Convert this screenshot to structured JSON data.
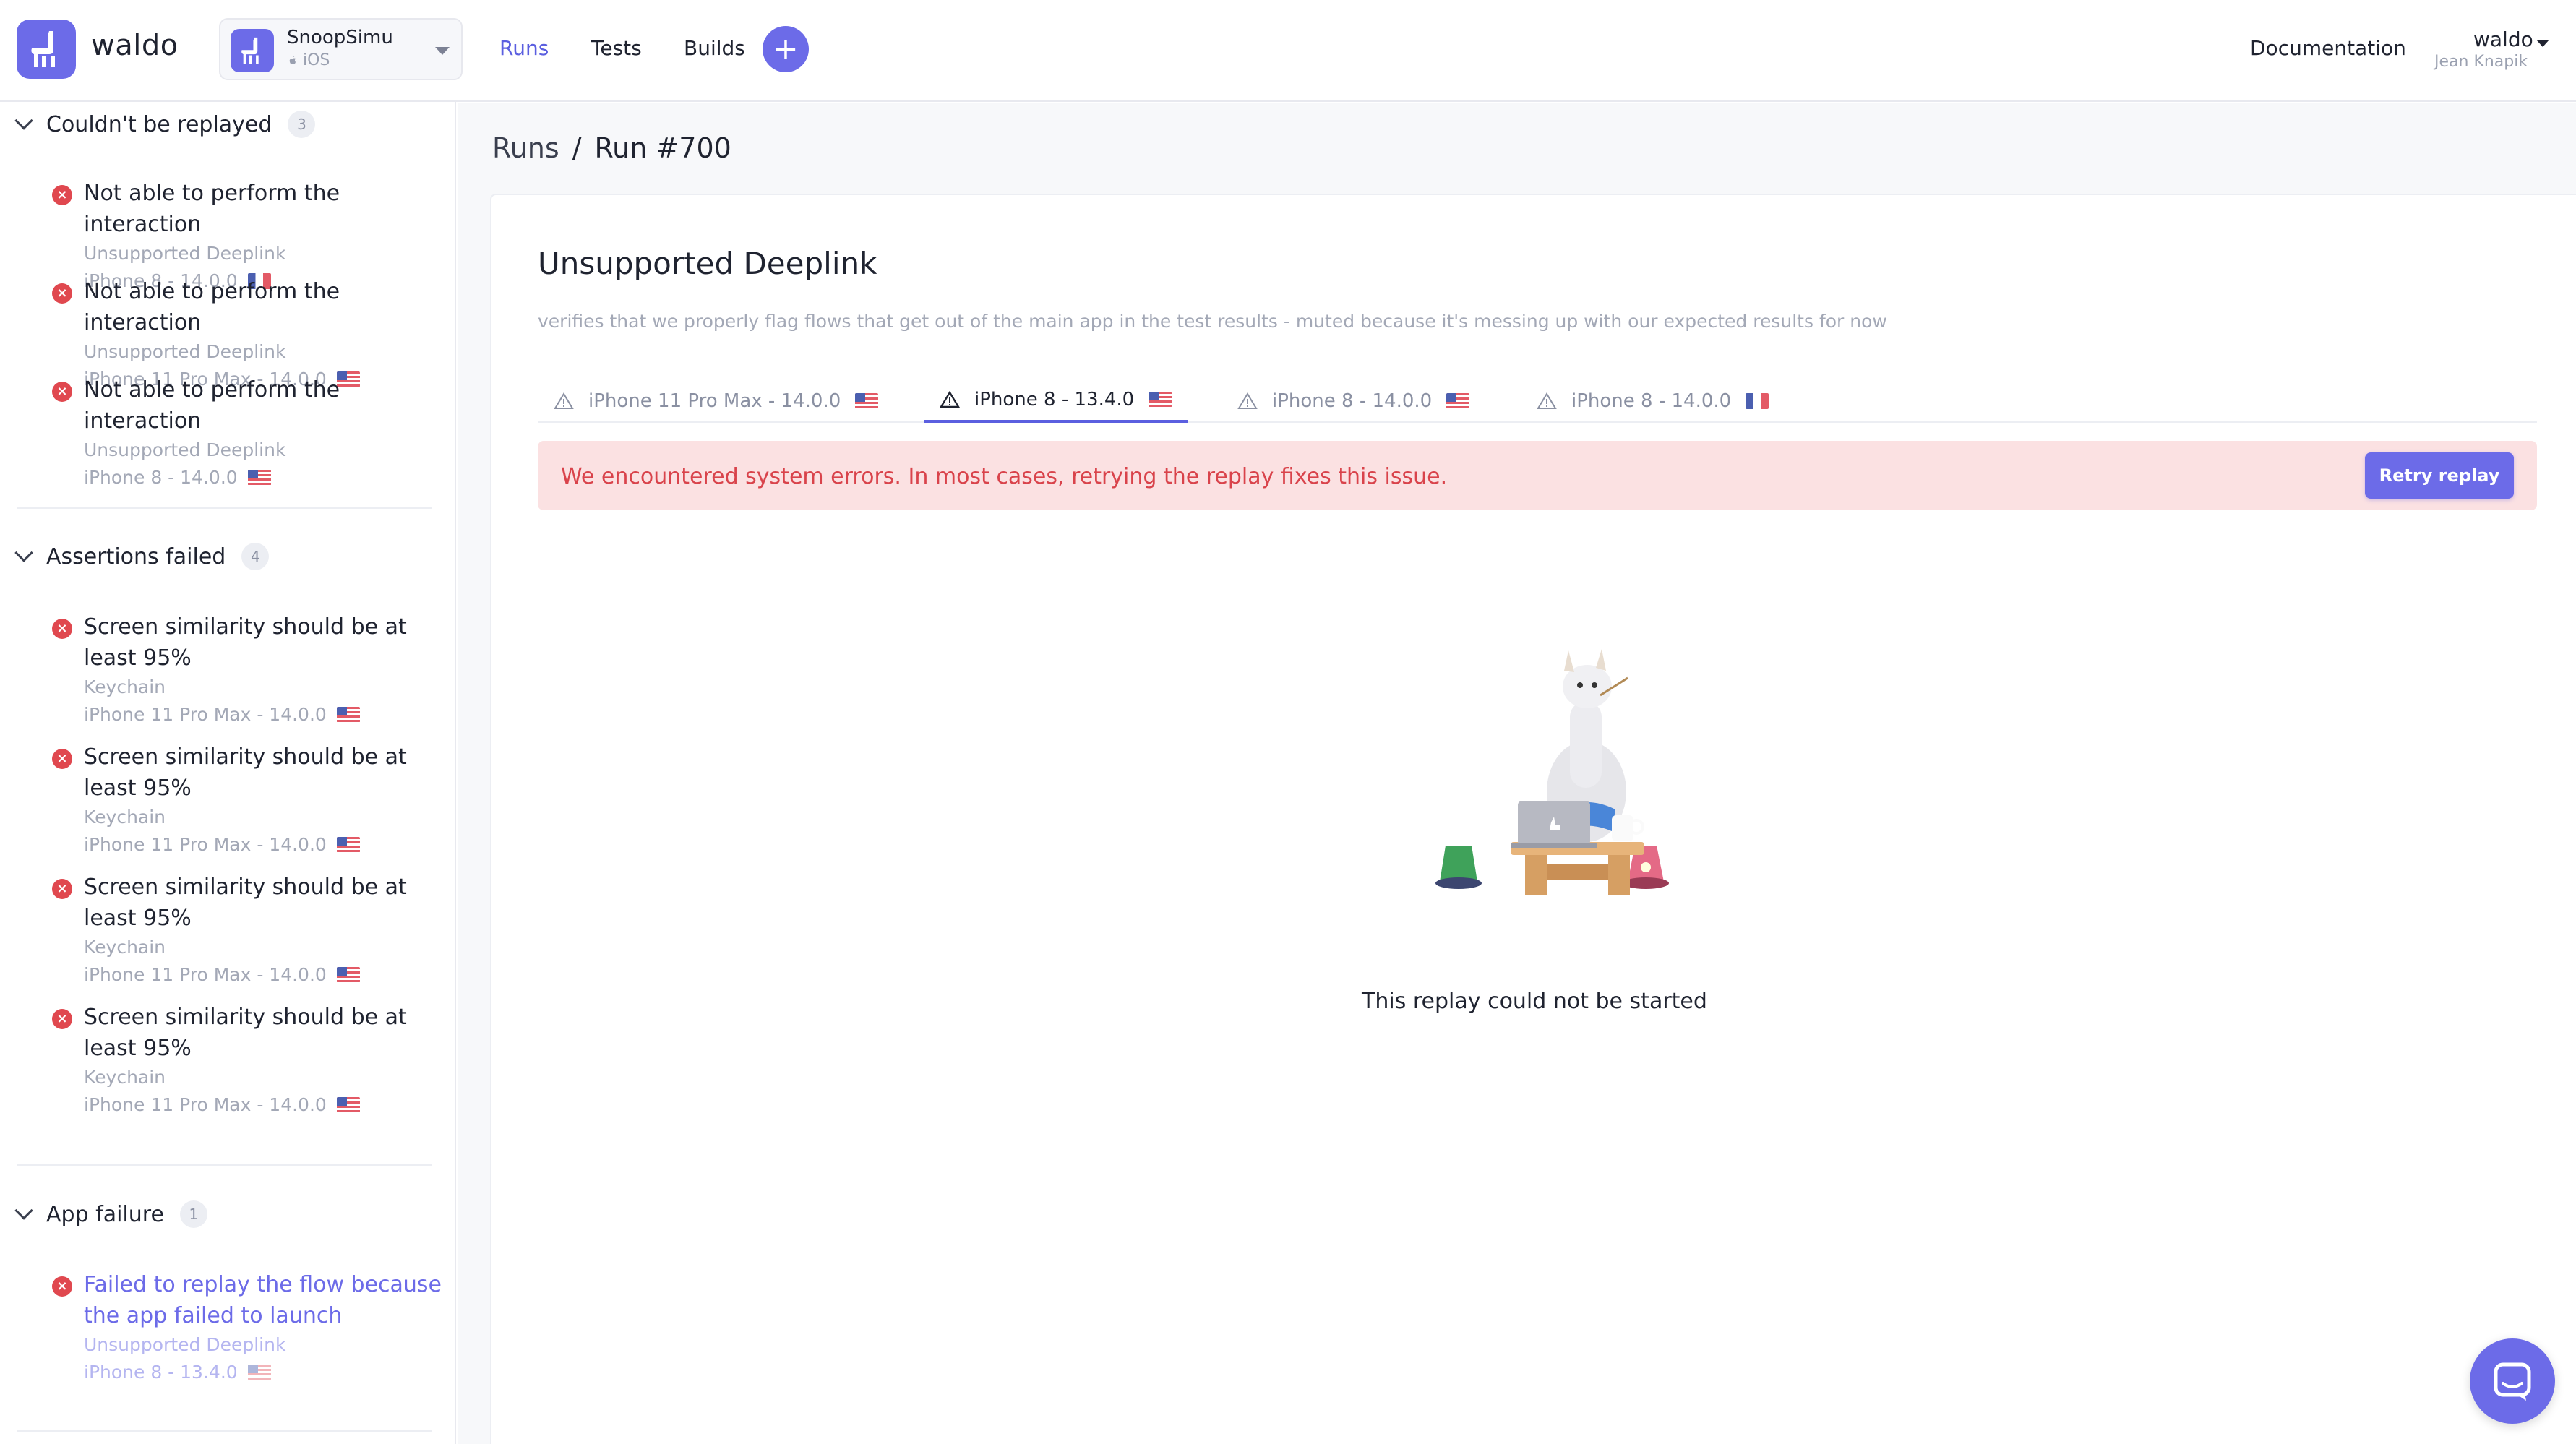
{
  "header": {
    "brand": "waldo",
    "app": {
      "name": "SnoopSimu",
      "platform": "iOS"
    },
    "nav": [
      "Runs",
      "Tests",
      "Builds"
    ],
    "add_label": "+",
    "documentation": "Documentation",
    "user": {
      "name": "waldo",
      "subtitle": "Jean Knapik"
    }
  },
  "sidebar": {
    "sections": [
      {
        "title": "Couldn't be replayed",
        "count": "3",
        "items": [
          {
            "title": "Not able to perform the interaction",
            "subtitle": "Unsupported Deeplink",
            "device": "iPhone 8 - 14.0.0",
            "flag": "fr"
          },
          {
            "title": "Not able to perform the interaction",
            "subtitle": "Unsupported Deeplink",
            "device": "iPhone 11 Pro Max - 14.0.0",
            "flag": "us"
          },
          {
            "title": "Not able to perform the interaction",
            "subtitle": "Unsupported Deeplink",
            "device": "iPhone 8 - 14.0.0",
            "flag": "us"
          }
        ]
      },
      {
        "title": "Assertions failed",
        "count": "4",
        "items": [
          {
            "title": "Screen similarity should be at least 95%",
            "subtitle": "Keychain",
            "device": "iPhone 11 Pro Max - 14.0.0",
            "flag": "us"
          },
          {
            "title": "Screen similarity should be at least 95%",
            "subtitle": "Keychain",
            "device": "iPhone 11 Pro Max - 14.0.0",
            "flag": "us"
          },
          {
            "title": "Screen similarity should be at least 95%",
            "subtitle": "Keychain",
            "device": "iPhone 11 Pro Max - 14.0.0",
            "flag": "us"
          },
          {
            "title": "Screen similarity should be at least 95%",
            "subtitle": "Keychain",
            "device": "iPhone 11 Pro Max - 14.0.0",
            "flag": "us"
          }
        ]
      },
      {
        "title": "App failure",
        "count": "1",
        "items": [
          {
            "title": "Failed to replay the flow because the app failed to launch",
            "subtitle": "Unsupported Deeplink",
            "device": "iPhone 8 - 13.4.0",
            "flag": "us"
          }
        ]
      }
    ]
  },
  "main": {
    "breadcrumb": {
      "parent": "Runs",
      "separator": "/",
      "current": "Run #700"
    },
    "title": "Unsupported Deeplink",
    "description": "verifies that we properly flag flows that get out of the main app in the test results - muted because it's messing up with our expected results for now",
    "tabs": [
      {
        "label": "iPhone 11 Pro Max - 14.0.0",
        "flag": "us",
        "active": false
      },
      {
        "label": "iPhone 8 - 13.4.0",
        "flag": "us",
        "active": true
      },
      {
        "label": "iPhone 8 - 14.0.0",
        "flag": "us",
        "active": false
      },
      {
        "label": "iPhone 8 - 14.0.0",
        "flag": "fr",
        "active": false
      }
    ],
    "alert": {
      "message": "We encountered system errors. In most cases, retrying the replay fixes this issue.",
      "button": "Retry replay"
    },
    "empty_state": "This replay could not be started"
  },
  "colors": {
    "accent": "#6c6be8",
    "error": "#e0484f",
    "alert_bg": "#fbe1e2"
  }
}
